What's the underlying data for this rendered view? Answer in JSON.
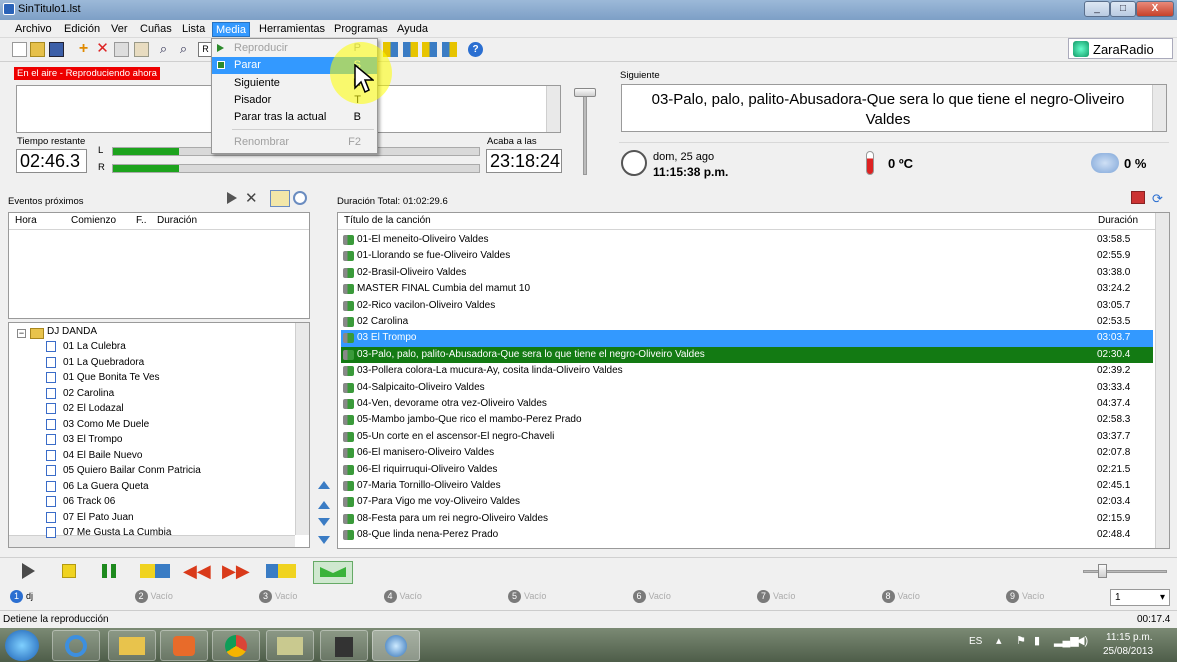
{
  "window": {
    "title": "SinTitulo1.lst",
    "min": "_",
    "max": "□",
    "close": "X"
  },
  "menubar": [
    "Archivo",
    "Edición",
    "Ver",
    "Cuñas",
    "Lista",
    "Media",
    "Herramientas",
    "Programas",
    "Ayuda"
  ],
  "active_menu": "Media",
  "media_menu": [
    {
      "label": "Reproducir",
      "key": "P",
      "disabled": true
    },
    {
      "label": "Parar",
      "key": "S",
      "highlighted": true
    },
    {
      "label": "Siguiente",
      "key": "N"
    },
    {
      "label": "Pisador",
      "key": "T"
    },
    {
      "label": "Parar tras la actual",
      "key": "B"
    },
    {
      "label": "Renombrar",
      "key": "F2",
      "disabled": true
    }
  ],
  "brand": "ZaraRadio",
  "on_air": {
    "label": "En el aire - Reproduciendo ahora"
  },
  "remaining": {
    "label": "Tiempo restante",
    "value": "02:46.3"
  },
  "ends_at": {
    "label": "Acaba a las",
    "value": "23:18:24"
  },
  "meters": {
    "L": 0.18,
    "R": 0.18,
    "L_label": "L",
    "R_label": "R"
  },
  "next": {
    "label": "Siguiente",
    "value": "03-Palo, palo, palito-Abusadora-Que sera lo que tiene el negro-Oliveiro Valdes"
  },
  "clock": {
    "date": "dom, 25 ago",
    "time": "11:15:38 p.m."
  },
  "temperature": "0 ºC",
  "humidity": "0 %",
  "events": {
    "label": "Eventos próximos",
    "columns": [
      "Hora",
      "Comienzo",
      "F..",
      "Duración"
    ]
  },
  "tree": {
    "root": "DJ DANDA",
    "items": [
      "01 La Culebra",
      "01 La Quebradora",
      "01 Que Bonita Te Ves",
      "02 Carolina",
      "02 El Lodazal",
      "03 Como Me Duele",
      "03 El Trompo",
      "04 El Baile Nuevo",
      "05 Quiero Bailar Conm Patricia",
      "06 La Guera Queta",
      "06 Track 06",
      "07 El Pato Juan",
      "07 Me Gusta La Cumbia"
    ]
  },
  "playlist": {
    "total": "Duración Total: 01:02:29.6",
    "columns": [
      "Título de la canción",
      "Duración"
    ],
    "rows": [
      {
        "title": "01-El meneito-Oliveiro Valdes",
        "dur": "03:58.5"
      },
      {
        "title": "01-Llorando se fue-Oliveiro Valdes",
        "dur": "02:55.9"
      },
      {
        "title": "02-Brasil-Oliveiro Valdes",
        "dur": "03:38.0"
      },
      {
        "title": "MASTER FINAL Cumbia del mamut 10",
        "dur": "03:24.2"
      },
      {
        "title": "02-Rico vacilon-Oliveiro Valdes",
        "dur": "03:05.7"
      },
      {
        "title": "02 Carolina",
        "dur": "02:53.5"
      },
      {
        "title": "03 El Trompo",
        "dur": "03:03.7",
        "state": "selected"
      },
      {
        "title": "03-Palo, palo, palito-Abusadora-Que sera lo que tiene el negro-Oliveiro Valdes",
        "dur": "02:30.4",
        "state": "playing"
      },
      {
        "title": "03-Pollera colora-La mucura-Ay, cosita linda-Oliveiro Valdes",
        "dur": "02:39.2"
      },
      {
        "title": "04-Salpicaito-Oliveiro Valdes",
        "dur": "03:33.4"
      },
      {
        "title": "04-Ven, devorame otra vez-Oliveiro Valdes",
        "dur": "04:37.4"
      },
      {
        "title": "05-Mambo jambo-Que rico el mambo-Perez Prado",
        "dur": "02:58.3"
      },
      {
        "title": "05-Un corte en el ascensor-El negro-Chaveli",
        "dur": "03:37.7"
      },
      {
        "title": "06-El manisero-Oliveiro Valdes",
        "dur": "02:07.8"
      },
      {
        "title": "06-El riquirruqui-Oliveiro Valdes",
        "dur": "02:21.5"
      },
      {
        "title": "07-Maria Tornillo-Oliveiro Valdes",
        "dur": "02:45.1"
      },
      {
        "title": "07-Para Vigo me voy-Oliveiro Valdes",
        "dur": "02:03.4"
      },
      {
        "title": "08-Festa para um rei negro-Oliveiro Valdes",
        "dur": "02:15.9"
      },
      {
        "title": "08-Que linda nena-Perez Prado",
        "dur": "02:48.4"
      }
    ]
  },
  "slots": [
    {
      "n": "1",
      "label": "dj"
    },
    {
      "n": "2",
      "label": "Vacío"
    },
    {
      "n": "3",
      "label": "Vacío"
    },
    {
      "n": "4",
      "label": "Vacío"
    },
    {
      "n": "5",
      "label": "Vacío"
    },
    {
      "n": "6",
      "label": "Vacío"
    },
    {
      "n": "7",
      "label": "Vacío"
    },
    {
      "n": "8",
      "label": "Vacío"
    },
    {
      "n": "9",
      "label": "Vacío"
    }
  ],
  "slot_select": "1",
  "status": {
    "text": "Detiene la reproducción",
    "elapsed": "00:17.4"
  },
  "taskbar": {
    "lang": "ES",
    "time": "11:15 p.m.",
    "date": "25/08/2013"
  },
  "colors": {
    "selected": "#3399ff",
    "playing": "#137a13",
    "on_air": "#ee0000",
    "meter": "#1da31d"
  }
}
